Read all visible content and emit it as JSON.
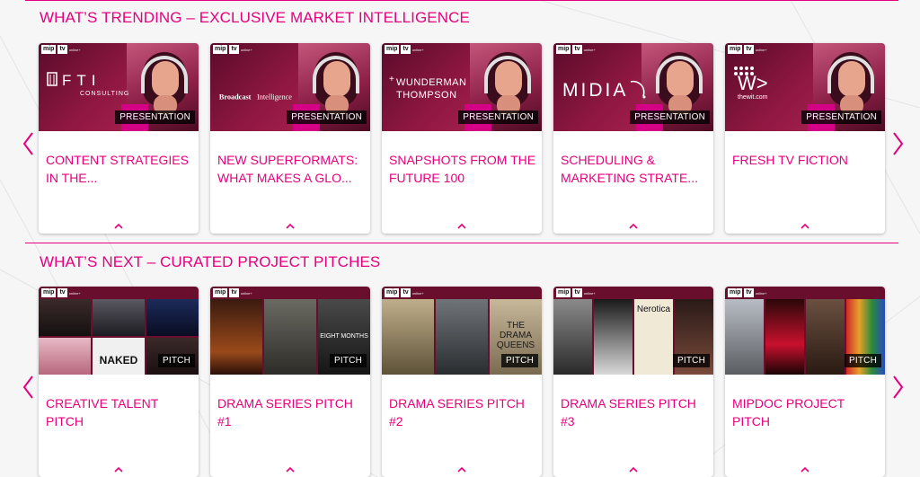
{
  "sections": [
    {
      "title": "WHAT’S TRENDING – EXCLUSIVE MARKET INTELLIGENCE",
      "cards": [
        {
          "brand": "FTI CONSULTING",
          "badge": "PRESENTATION",
          "title": "CONTENT STRATEGIES IN THE..."
        },
        {
          "brand": "Broadcast Intelligence",
          "badge": "PRESENTATION",
          "title": "NEW SUPERFORMATS: WHAT MAKES A GLO..."
        },
        {
          "brand": "WUNDERMAN THOMPSON",
          "badge": "PRESENTATION",
          "title": "SNAPSHOTS FROM THE FUTURE 100"
        },
        {
          "brand": "MIDiA",
          "badge": "PRESENTATION",
          "title": "SCHEDULING & MARKETING STRATE..."
        },
        {
          "brand": "thewit.com",
          "badge": "PRESENTATION",
          "title": "FRESH TV FICTION"
        }
      ]
    },
    {
      "title": "WHAT’S NEXT – CURATED PROJECT PITCHES",
      "cards": [
        {
          "badge": "PITCH",
          "title": "CREATIVE TALENT PITCH",
          "tile_text": "NAKED"
        },
        {
          "badge": "PITCH",
          "title": "DRAMA SERIES PITCH #1",
          "tile_text": "EIGHT MONTHS"
        },
        {
          "badge": "PITCH",
          "title": "DRAMA SERIES PITCH #2",
          "tile_text": "THE DRAMA QUEENS"
        },
        {
          "badge": "PITCH",
          "title": "DRAMA SERIES PITCH #3",
          "tile_text": "Nerotica"
        },
        {
          "badge": "PITCH",
          "title": "MIPDOC PROJECT PITCH",
          "tile_text": ""
        }
      ]
    }
  ],
  "logo": {
    "mip": "mip",
    "tv": "tv",
    "sub": "online+"
  },
  "colors": {
    "accent": "#e6007e",
    "dark_magenta": "#6a0e2e"
  },
  "icons": {
    "prev": "chevron-left-icon",
    "next": "chevron-right-icon",
    "expand": "chevron-up-icon"
  }
}
